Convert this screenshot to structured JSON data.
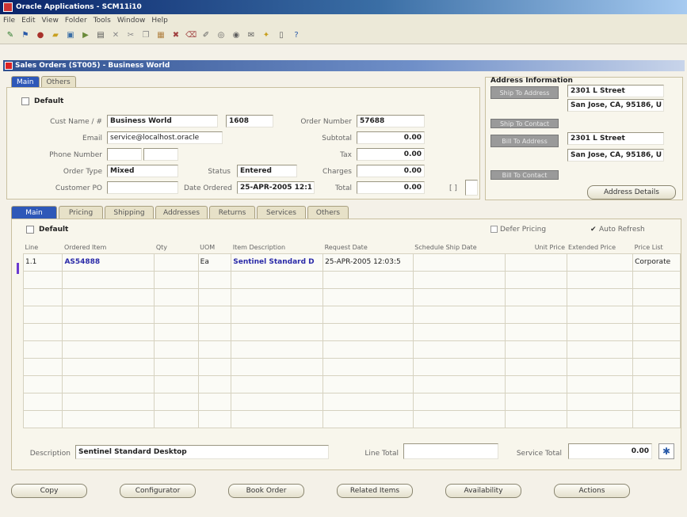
{
  "window": {
    "title": "Oracle Applications - SCM11i10"
  },
  "menu": [
    "File",
    "Edit",
    "View",
    "Folder",
    "Tools",
    "Window",
    "Help"
  ],
  "form": {
    "title": "Sales Orders (ST005) - Business World"
  },
  "header_tabs": [
    "Main",
    "Others"
  ],
  "main": {
    "default_label": "Default",
    "cust_name_label": "Cust Name / #",
    "cust_name_value": "Business World",
    "cust_number_value": "1608",
    "order_number_label": "Order Number",
    "order_number_value": "57688",
    "email_label": "Email",
    "email_value": "service@localhost.oracle",
    "subtotal_label": "Subtotal",
    "subtotal_value": "0.00",
    "phone_label": "Phone Number",
    "tax_label": "Tax",
    "tax_value": "0.00",
    "order_type_label": "Order Type",
    "order_type_value": "Mixed",
    "status_label": "Status",
    "status_value": "Entered",
    "charges_label": "Charges",
    "charges_value": "0.00",
    "customer_po_label": "Customer PO",
    "date_ordered_label": "Date Ordered",
    "date_ordered_value": "25-APR-2005 12:1",
    "total_label": "Total",
    "total_value": "0.00",
    "total_bracket": "[ ]"
  },
  "address": {
    "title": "Address Information",
    "ship_to_address_btn": "Ship To Address",
    "ship_to_line1": "2301 L Street",
    "ship_to_line2": "San Jose, CA, 95186, U",
    "ship_to_contact_btn": "Ship To Contact",
    "bill_to_address_btn": "Bill To Address",
    "bill_to_line1": "2301 L Street",
    "bill_to_line2": "San Jose, CA, 95186, U",
    "bill_to_contact_btn": "Bill To Contact",
    "address_details_btn": "Address Details"
  },
  "line_tabs": [
    "Main",
    "Pricing",
    "Shipping",
    "Addresses",
    "Returns",
    "Services",
    "Others"
  ],
  "lines": {
    "default_label": "Default",
    "defer_pricing_label": "Defer Pricing",
    "auto_refresh_label": "Auto Refresh",
    "columns": [
      "Line",
      "Ordered Item",
      "Qty",
      "UOM",
      "Item Description",
      "Request Date",
      "Schedule Ship Date",
      "Unit Price",
      "Extended Price",
      "Price List"
    ],
    "rows": [
      [
        "1.1",
        "AS54888",
        "",
        "Ea",
        "Sentinel Standard D",
        "25-APR-2005 12:03:5",
        "",
        "",
        "",
        "Corporate"
      ]
    ],
    "description_label": "Description",
    "description_value": "Sentinel Standard Desktop",
    "line_total_label": "Line Total",
    "service_total_label": "Service Total",
    "service_total_value": "0.00"
  },
  "bottom_buttons": [
    "Copy",
    "Configurator",
    "Book Order",
    "Related Items",
    "Availability",
    "Actions"
  ]
}
